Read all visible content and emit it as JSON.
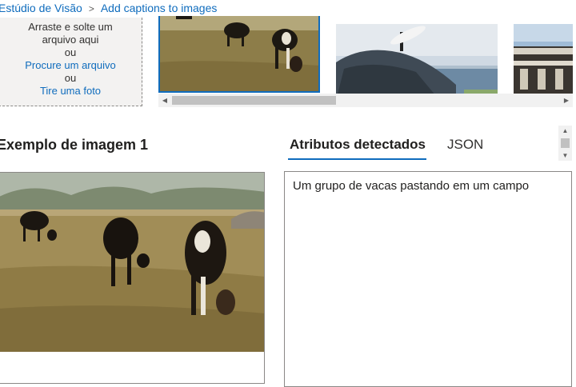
{
  "breadcrumb": {
    "root": "Estúdio de Visão",
    "separator": ">",
    "current": "Add captions to images"
  },
  "upload": {
    "drag_text": "Arraste e solte um arquivo aqui",
    "or_1": "ou",
    "browse_link": "Procure um arquivo",
    "or_2": "ou",
    "photo_link": "Tire uma foto"
  },
  "thumbnails": [
    {
      "icon": "cows-thumbnail",
      "selected": true
    },
    {
      "icon": "surfer-thumbnail",
      "selected": false
    },
    {
      "icon": "building-thumbnail",
      "selected": false
    }
  ],
  "scrollbar": {
    "left_arrow": "◀",
    "right_arrow": "▶",
    "up_arrow": "▲",
    "down_arrow": "▼"
  },
  "sample": {
    "title": "Exemplo de imagem 1"
  },
  "tabs": [
    {
      "label": "Atributos detectados",
      "active": true
    },
    {
      "label": "JSON",
      "active": false
    }
  ],
  "result": {
    "caption": "Um grupo de vacas pastando em um campo"
  },
  "colors": {
    "accent": "#0f6cbd",
    "border": "#8a8886",
    "upload_bg": "#f3f2f1"
  }
}
